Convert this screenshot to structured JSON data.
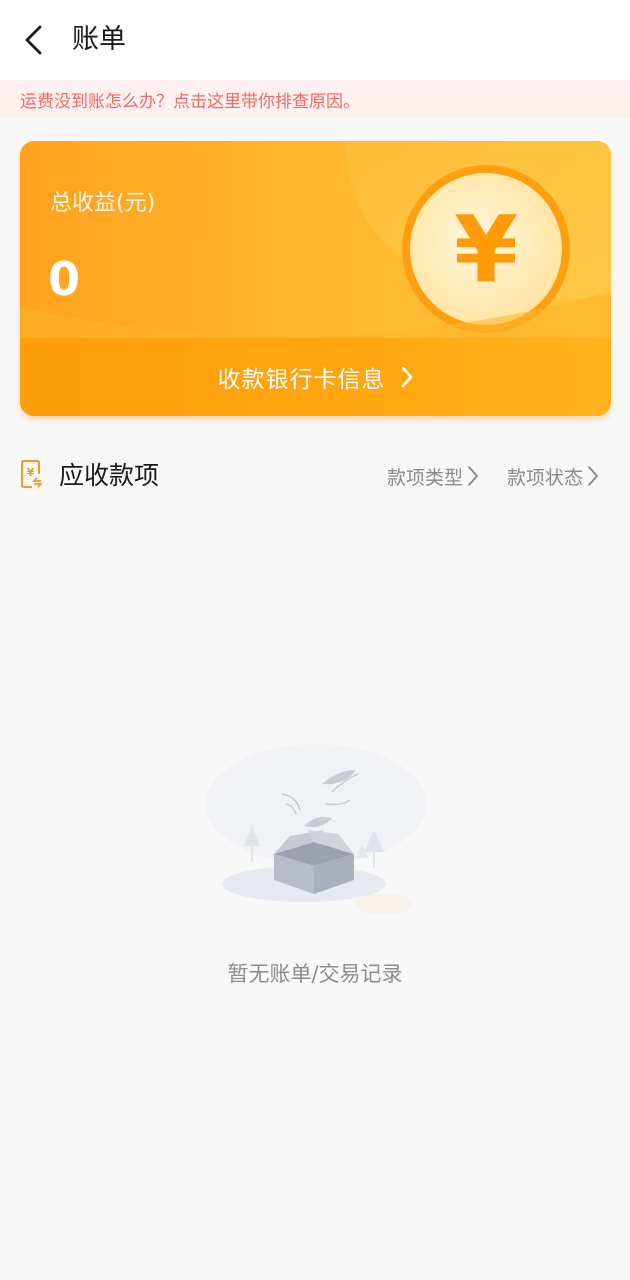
{
  "header": {
    "title": "账单",
    "back_icon": "chevron-left-icon"
  },
  "notice": {
    "text": "运费没到账怎么办？点击这里带你排查原因。",
    "color": "#ec6c63"
  },
  "earnings_card": {
    "label": "总收益(元)",
    "value": "0",
    "bank_link_label": "收款银行卡信息",
    "coin_symbol": "¥",
    "accent_color": "#ffa21e"
  },
  "receivables": {
    "title": "应收款项",
    "icon": "receipt-icon",
    "filters": [
      {
        "label": "款项类型"
      },
      {
        "label": "款项状态"
      }
    ]
  },
  "empty_state": {
    "text": "暂无账单/交易记录",
    "icon": "empty-box-icon"
  }
}
